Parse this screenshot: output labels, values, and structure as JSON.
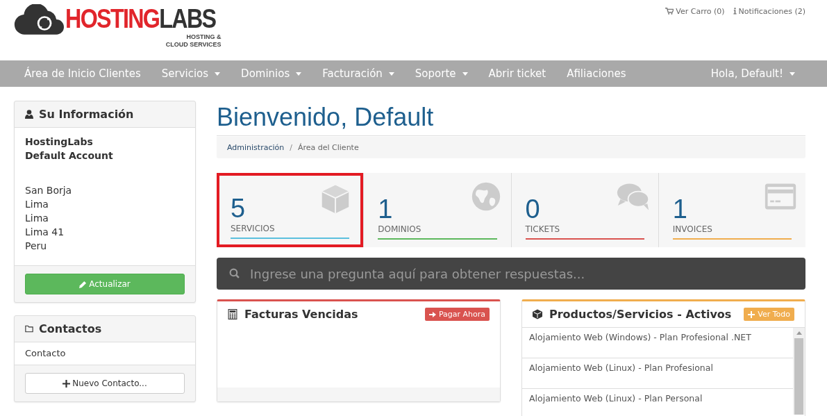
{
  "logo": {
    "brand_a": "HOSTING",
    "brand_b": "LABS",
    "tagline_1": "HOSTING &",
    "tagline_2": "CLOUD SERVICES"
  },
  "top_links": [
    {
      "kind": "cart",
      "label": "Ver Carro (0)"
    },
    {
      "kind": "info",
      "label": "Notificaciones (2)"
    }
  ],
  "nav": {
    "items": [
      {
        "label": "Área de Inicio Clientes",
        "dropdown": false
      },
      {
        "label": "Servicios",
        "dropdown": true
      },
      {
        "label": "Dominios",
        "dropdown": true
      },
      {
        "label": "Facturación",
        "dropdown": true
      },
      {
        "label": "Soporte",
        "dropdown": true
      },
      {
        "label": "Abrir ticket",
        "dropdown": false
      },
      {
        "label": "Afiliaciones",
        "dropdown": false
      }
    ],
    "user": {
      "label": "Hola, Default!",
      "dropdown": true
    }
  },
  "info_panel": {
    "title": "Su Información",
    "company": "HostingLabs",
    "account": "Default Account",
    "address": [
      "San Borja",
      "Lima",
      "Lima",
      "Lima 41",
      "Peru"
    ],
    "button": "Actualizar"
  },
  "contacts_panel": {
    "title": "Contactos",
    "items": [
      "Contacto"
    ],
    "button": "Nuevo Contacto..."
  },
  "page_title": "Bienvenido, Default",
  "breadcrumb": {
    "separator": "/",
    "items": [
      {
        "label": "Administración",
        "link": true
      },
      {
        "label": "Área del Cliente",
        "link": false
      }
    ]
  },
  "stats": [
    {
      "value": "5",
      "label": "SERVICIOS",
      "kind": "cube",
      "color": "#5bc0de",
      "highlighted": true
    },
    {
      "value": "1",
      "label": "DOMINIOS",
      "kind": "globe",
      "color": "#5cb85c",
      "highlighted": false
    },
    {
      "value": "0",
      "label": "TICKETS",
      "kind": "comments",
      "color": "#d9534f",
      "highlighted": false
    },
    {
      "value": "1",
      "label": "INVOICES",
      "kind": "card",
      "color": "#f0ad4e",
      "highlighted": false
    }
  ],
  "search": {
    "placeholder": "Ingrese una pregunta aquí para obtener respuestas..."
  },
  "overdue_panel": {
    "title": "Facturas Vencidas",
    "button": "Pagar Ahora"
  },
  "products_panel": {
    "title": "Productos/Servicios - Activos",
    "button": "Ver Todo",
    "items": [
      "Alojamiento Web (Windows) - Plan Profesional .NET",
      "Alojamiento Web (Linux) - Plan Profesional",
      "Alojamiento Web (Linux) - Plan Personal"
    ]
  }
}
